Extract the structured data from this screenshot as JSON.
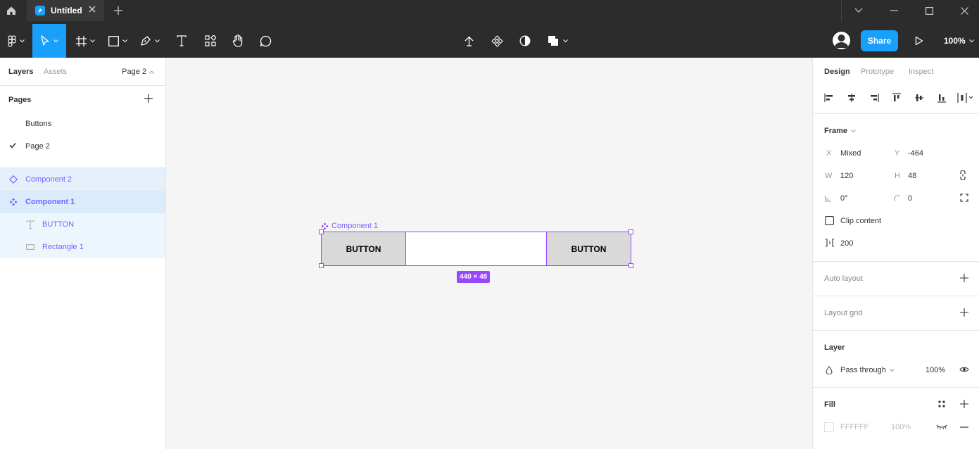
{
  "titlebar": {
    "file_tab": "Untitled"
  },
  "toolbar": {
    "share_label": "Share",
    "zoom_level": "100%"
  },
  "left_panel": {
    "tabs": {
      "layers": "Layers",
      "assets": "Assets"
    },
    "page_selector": "Page 2",
    "pages_title": "Pages",
    "pages": [
      {
        "label": "Buttons",
        "selected": false
      },
      {
        "label": "Page 2",
        "selected": true
      }
    ],
    "layers": [
      {
        "label": "Component 2",
        "kind": "component-instance-icon"
      },
      {
        "label": "Component 1",
        "kind": "component-icon"
      },
      {
        "label": "BUTTON",
        "kind": "text-layer-icon"
      },
      {
        "label": "Rectangle 1",
        "kind": "rectangle-layer-icon"
      }
    ]
  },
  "canvas": {
    "frame_label": "Component 1",
    "left_button_text": "BUTTON",
    "right_button_text": "BUTTON",
    "size_badge": "440 × 48",
    "selection_color": "#9747ff"
  },
  "right_panel": {
    "tabs": {
      "design": "Design",
      "prototype": "Prototype",
      "inspect": "Inspect"
    },
    "frame": {
      "title": "Frame",
      "x_label": "X",
      "x_value": "Mixed",
      "y_label": "Y",
      "y_value": "-464",
      "w_label": "W",
      "w_value": "120",
      "h_label": "H",
      "h_value": "48",
      "rotation": "0°",
      "radius": "0",
      "clip_content": "Clip content",
      "spacing": "200"
    },
    "auto_layout": "Auto layout",
    "layout_grid": "Layout grid",
    "layer": {
      "title": "Layer",
      "blend": "Pass through",
      "opacity": "100%"
    },
    "fill": {
      "title": "Fill",
      "hex": "FFFFFF",
      "opacity": "100%"
    }
  },
  "colors": {
    "accent": "#18a0fb",
    "component": "#7b61ff",
    "toolbar_bg": "#2c2c2c"
  }
}
